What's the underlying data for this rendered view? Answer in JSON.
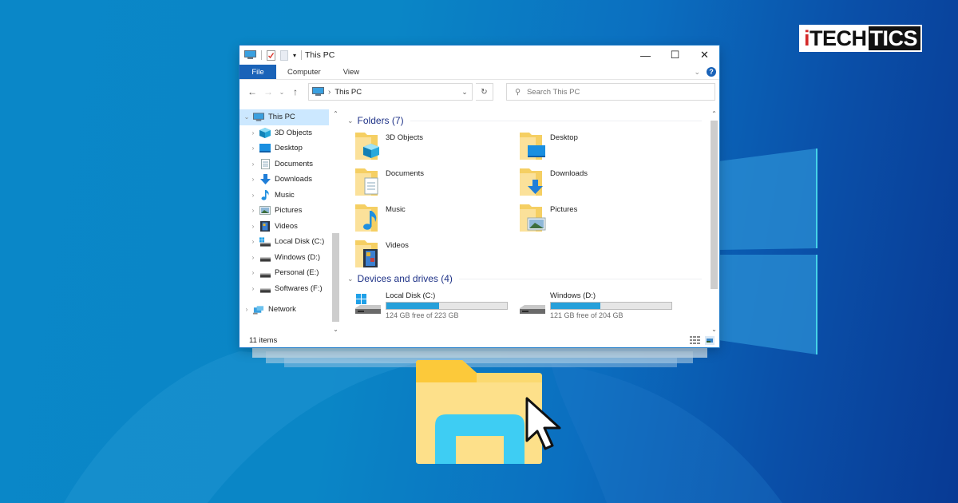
{
  "brand": {
    "part1_accent": "i",
    "part1": "TECH",
    "part2": "TICS"
  },
  "window": {
    "title": "This PC",
    "caption": {
      "minimize": "—",
      "maximize": "☐",
      "close": "✕"
    },
    "ribbon": {
      "tabs": [
        {
          "label": "File",
          "active": true
        },
        {
          "label": "Computer"
        },
        {
          "label": "View"
        }
      ],
      "expand_icon": "chevron-down-icon",
      "help": "?"
    },
    "navigation": {
      "back": "←",
      "forward": "→",
      "recent": "⌄",
      "up": "↑"
    },
    "address": {
      "separator": "›",
      "location": "This PC",
      "dropdown": "⌄",
      "refresh": "↻"
    },
    "search": {
      "placeholder": "Search This PC",
      "icon": "⚲"
    },
    "nav_pane": {
      "root": {
        "label": "This PC",
        "expanded": true,
        "selected": true
      },
      "items": [
        {
          "label": "3D Objects",
          "icon": "cube-icon"
        },
        {
          "label": "Desktop",
          "icon": "desktop-icon"
        },
        {
          "label": "Documents",
          "icon": "documents-icon"
        },
        {
          "label": "Downloads",
          "icon": "download-icon"
        },
        {
          "label": "Music",
          "icon": "music-icon"
        },
        {
          "label": "Pictures",
          "icon": "pictures-icon"
        },
        {
          "label": "Videos",
          "icon": "videos-icon"
        },
        {
          "label": "Local Disk (C:)",
          "icon": "windows-drive-icon"
        },
        {
          "label": "Windows (D:)",
          "icon": "drive-icon"
        },
        {
          "label": "Personal (E:)",
          "icon": "drive-icon"
        },
        {
          "label": "Softwares (F:)",
          "icon": "drive-icon"
        }
      ],
      "network": {
        "label": "Network"
      }
    },
    "content": {
      "folders_header": "Folders (7)",
      "folders": [
        {
          "label": "3D Objects"
        },
        {
          "label": "Desktop"
        },
        {
          "label": "Documents"
        },
        {
          "label": "Downloads"
        },
        {
          "label": "Music"
        },
        {
          "label": "Pictures"
        },
        {
          "label": "Videos"
        }
      ],
      "drives_header": "Devices and drives (4)",
      "drives": [
        {
          "label": "Local Disk (C:)",
          "free": "124 GB free of 223 GB",
          "used_fraction": 0.44
        },
        {
          "label": "Windows (D:)",
          "free": "121 GB free of 204 GB",
          "used_fraction": 0.41
        }
      ]
    },
    "status": {
      "items": "11 items"
    }
  },
  "colors": {
    "accent": "#1a63b8",
    "selection": "#cce8ff",
    "group_header": "#1e3287",
    "drive_bar": "#26a0da",
    "folder_yellow": "#f8d775",
    "desktop_blue": "#0a86c6"
  }
}
